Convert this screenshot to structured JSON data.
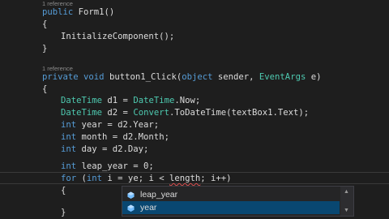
{
  "code": {
    "ref1": "1 reference",
    "ctor_public": "public",
    "ctor_name": " Form1()",
    "l_open1": "{",
    "l_init": "InitializeComponent();",
    "l_close1": "}",
    "ref2": "1 reference",
    "m_private": "private",
    "m_void": "void",
    "m_name": " button1_Click(",
    "m_object": "object",
    "m_sender": " sender, ",
    "m_eventargs": "EventArgs",
    "m_e": " e)",
    "l_open2": "{",
    "d1_type": "DateTime",
    "d1_mid": " d1 = ",
    "d1_type2": "DateTime",
    "d1_end": ".Now;",
    "d2_type": "DateTime",
    "d2_mid": " d2 = ",
    "d2_convert": "Convert",
    "d2_end": ".ToDateTime(textBox1.Text);",
    "year_int": "int",
    "year_rest": " year = d2.Year;",
    "month_int": "int",
    "month_rest": " month = d2.Month;",
    "day_int": "int",
    "day_rest": " day = d2.Day;",
    "leap_int": "int",
    "leap_rest": " leap_year = 0;",
    "for_kw": "for",
    "for_a": " (",
    "for_int": "int",
    "for_b": " i = ye",
    "for_c": "; i < ",
    "for_length": "length",
    "for_d": "; i++)",
    "l_open3": "{",
    "l_close3": "}"
  },
  "autocomplete": {
    "items": [
      {
        "label": "leap_year",
        "icon": "local-variable-icon"
      },
      {
        "label": "year",
        "icon": "local-variable-icon"
      }
    ],
    "selected_index": 1
  },
  "colors": {
    "background": "#1e1e1e",
    "keyword": "#569cd6",
    "type": "#4ec9b0",
    "text": "#dcdcdc",
    "selection": "#094771"
  }
}
